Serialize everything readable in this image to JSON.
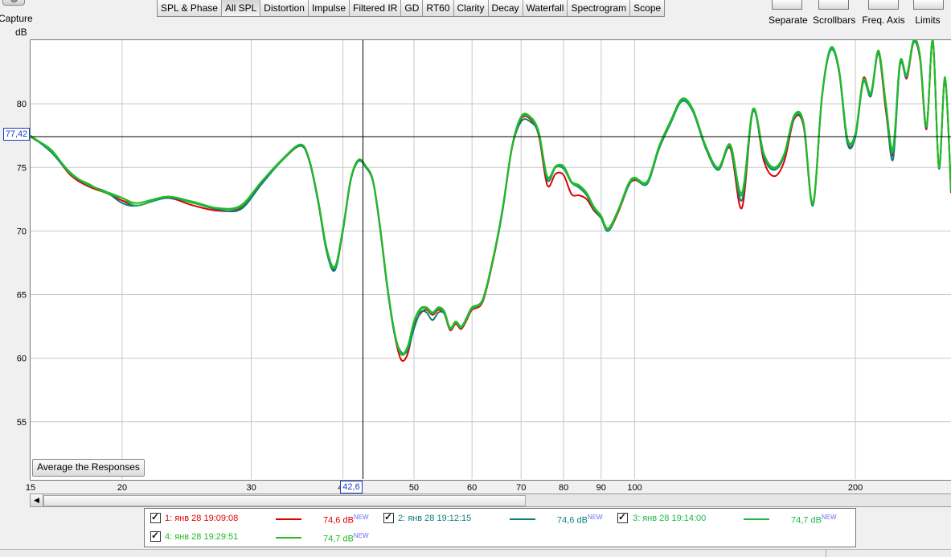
{
  "toolbar": {
    "capture_label": "Capture",
    "tabs": [
      "SPL & Phase",
      "All SPL",
      "Distortion",
      "Impulse",
      "Filtered IR",
      "GD",
      "RT60",
      "Clarity",
      "Decay",
      "Waterfall",
      "Spectrogram",
      "Scope"
    ],
    "active_tab": "All SPL",
    "tools": {
      "separate": "Separate",
      "scrollbars": "Scrollbars",
      "freq_axis": "Freq. Axis",
      "limits": "Limits"
    }
  },
  "plot": {
    "unit_label": "dB",
    "cursor_y_readout": "77,42",
    "cursor_x_readout": "42,6",
    "average_button": "Average the Responses"
  },
  "legend": [
    {
      "label": "1: янв 28 19:09:08",
      "value": "74,6 dB",
      "badge": "NEW",
      "color": "#e00000"
    },
    {
      "label": "2: янв 28 19:12:15",
      "value": "74,6 dB",
      "badge": "NEW",
      "color": "#0b7f7a"
    },
    {
      "label": "3: янв 28 19:14:00",
      "value": "74,7 dB",
      "badge": "NEW",
      "color": "#1bb84c"
    },
    {
      "label": "4: янв 28 19:29:51",
      "value": "74,7 dB",
      "badge": "NEW",
      "color": "#22bb22"
    }
  ],
  "chart_data": {
    "type": "line",
    "xscale": "log",
    "xlim": [
      15,
      270
    ],
    "ylim": [
      50.5,
      85
    ],
    "xticks": [
      15,
      20,
      30,
      40,
      50,
      60,
      70,
      80,
      90,
      100,
      200
    ],
    "xtick_labels": [
      "15",
      "20",
      "30",
      "40",
      "50",
      "60",
      "70",
      "80",
      "90",
      "100",
      "200"
    ],
    "yticks": [
      55,
      60,
      65,
      70,
      75,
      80
    ],
    "ytick_labels": [
      "55",
      "60",
      "65",
      "70",
      "75",
      "80"
    ],
    "grid": true,
    "cursor": {
      "x": 42.6,
      "y": 77.42
    },
    "x": [
      15,
      16,
      17,
      18,
      19,
      20,
      21,
      23,
      25,
      27,
      29,
      31,
      33,
      35,
      36,
      37,
      38,
      39,
      40,
      41,
      42,
      43,
      44,
      45,
      46,
      47,
      48,
      49,
      50,
      51,
      52,
      53,
      54,
      55,
      56,
      57,
      58,
      59,
      60,
      62,
      64,
      66,
      68,
      70,
      72,
      74,
      76,
      78,
      80,
      82,
      84,
      86,
      88,
      90,
      92,
      95,
      98,
      100,
      104,
      108,
      112,
      116,
      120,
      125,
      130,
      135,
      140,
      145,
      150,
      155,
      160,
      165,
      170,
      175,
      180,
      185,
      190,
      195,
      200,
      205,
      210,
      215,
      220,
      225,
      230,
      235,
      240,
      245,
      250,
      255,
      260,
      265,
      270
    ],
    "series": [
      {
        "name": "1: янв 28 19:09:08",
        "color": "#e00000",
        "values": [
          77.4,
          76.3,
          74.4,
          73.5,
          73.0,
          72.4,
          72.0,
          72.6,
          72.0,
          71.6,
          71.8,
          73.8,
          75.5,
          76.7,
          75.5,
          72.3,
          68.5,
          67.0,
          70.0,
          74.0,
          75.5,
          75.0,
          73.8,
          70.0,
          65.5,
          62.0,
          59.9,
          60.3,
          62.5,
          63.5,
          63.8,
          63.4,
          63.8,
          63.5,
          62.2,
          62.7,
          62.3,
          63.0,
          63.8,
          64.4,
          67.5,
          71.5,
          76.5,
          78.8,
          78.8,
          77.5,
          73.6,
          74.5,
          74.4,
          72.9,
          72.8,
          72.5,
          71.6,
          71.0,
          70.0,
          71.5,
          73.5,
          74.0,
          73.8,
          76.5,
          78.5,
          80.3,
          79.5,
          76.5,
          74.8,
          76.5,
          71.8,
          79.5,
          75.5,
          74.3,
          75.5,
          78.8,
          78.2,
          72.0,
          80.5,
          84.3,
          82.5,
          77.0,
          77.5,
          82.0,
          80.8,
          84.0,
          79.5,
          76.0,
          83.2,
          82.0,
          84.8,
          83.5,
          78.0,
          85.0,
          75.0,
          82.0,
          73.0
        ]
      },
      {
        "name": "2: янв 28 19:12:15",
        "color": "#0b7f7a",
        "values": [
          77.5,
          76.2,
          74.5,
          73.6,
          73.1,
          72.2,
          72.0,
          72.6,
          72.2,
          71.7,
          71.7,
          73.7,
          75.5,
          76.7,
          75.5,
          72.3,
          68.4,
          66.9,
          70.0,
          74.0,
          75.5,
          75.0,
          73.8,
          70.0,
          65.5,
          62.0,
          60.5,
          60.6,
          62.3,
          63.6,
          63.6,
          63.0,
          63.6,
          63.5,
          62.3,
          62.8,
          62.4,
          63.2,
          64.0,
          64.5,
          67.6,
          71.5,
          76.5,
          78.6,
          78.6,
          77.6,
          74.0,
          75.0,
          74.9,
          73.8,
          73.4,
          72.8,
          71.7,
          71.0,
          70.0,
          71.6,
          73.5,
          74.1,
          73.7,
          76.5,
          78.5,
          80.2,
          79.4,
          76.5,
          74.8,
          76.6,
          72.4,
          79.4,
          75.8,
          74.8,
          75.9,
          78.9,
          78.3,
          72.0,
          80.4,
          84.2,
          82.5,
          76.9,
          77.4,
          81.7,
          80.6,
          84.0,
          79.8,
          75.6,
          83.0,
          82.1,
          84.8,
          83.6,
          78.1,
          85.0,
          74.9,
          82.0,
          73.1
        ]
      },
      {
        "name": "3: янв 28 19:14:00",
        "color": "#1bb84c",
        "values": [
          77.5,
          76.3,
          74.6,
          73.6,
          73.1,
          72.6,
          72.0,
          72.7,
          72.2,
          71.8,
          71.9,
          73.9,
          75.6,
          76.8,
          75.6,
          72.4,
          68.6,
          67.1,
          70.1,
          74.1,
          75.6,
          75.1,
          73.9,
          70.1,
          65.6,
          62.1,
          60.3,
          60.8,
          62.8,
          63.8,
          63.9,
          63.5,
          63.9,
          63.6,
          62.3,
          62.8,
          62.4,
          63.1,
          63.9,
          64.5,
          67.6,
          71.6,
          76.6,
          78.9,
          78.9,
          77.7,
          74.2,
          75.0,
          75.0,
          73.8,
          73.5,
          72.9,
          71.8,
          71.1,
          70.1,
          71.6,
          73.6,
          74.1,
          73.8,
          76.6,
          78.6,
          80.3,
          79.5,
          76.6,
          74.9,
          76.7,
          72.8,
          79.5,
          76.0,
          74.9,
          76.0,
          79.0,
          78.4,
          72.1,
          80.5,
          84.3,
          82.6,
          77.2,
          77.6,
          81.8,
          80.8,
          84.1,
          80.0,
          76.3,
          83.2,
          82.2,
          84.9,
          83.7,
          78.2,
          85.0,
          75.0,
          82.0,
          73.2
        ]
      },
      {
        "name": "4: янв 28 19:29:51",
        "color": "#22bb22",
        "values": [
          77.4,
          76.4,
          74.5,
          73.7,
          73.0,
          72.6,
          72.2,
          72.7,
          72.3,
          71.8,
          72.0,
          73.9,
          75.5,
          76.8,
          75.6,
          72.5,
          68.7,
          67.2,
          70.2,
          74.1,
          75.6,
          75.1,
          73.9,
          70.2,
          65.7,
          62.2,
          60.4,
          60.9,
          62.9,
          63.9,
          64.0,
          63.6,
          64.0,
          63.7,
          62.4,
          62.9,
          62.5,
          63.2,
          64.0,
          64.6,
          67.7,
          71.7,
          76.6,
          79.0,
          79.0,
          77.8,
          74.3,
          75.1,
          75.1,
          73.9,
          73.6,
          73.0,
          71.9,
          71.2,
          70.2,
          71.7,
          73.7,
          74.2,
          73.9,
          76.7,
          78.7,
          80.4,
          79.6,
          76.7,
          75.0,
          76.8,
          73.0,
          79.6,
          76.1,
          75.0,
          76.1,
          79.1,
          78.5,
          72.2,
          80.6,
          84.4,
          82.7,
          77.3,
          77.7,
          81.9,
          80.9,
          84.2,
          80.1,
          76.5,
          83.3,
          82.3,
          85.0,
          83.8,
          78.3,
          85.0,
          75.1,
          82.1,
          73.3
        ]
      }
    ]
  }
}
